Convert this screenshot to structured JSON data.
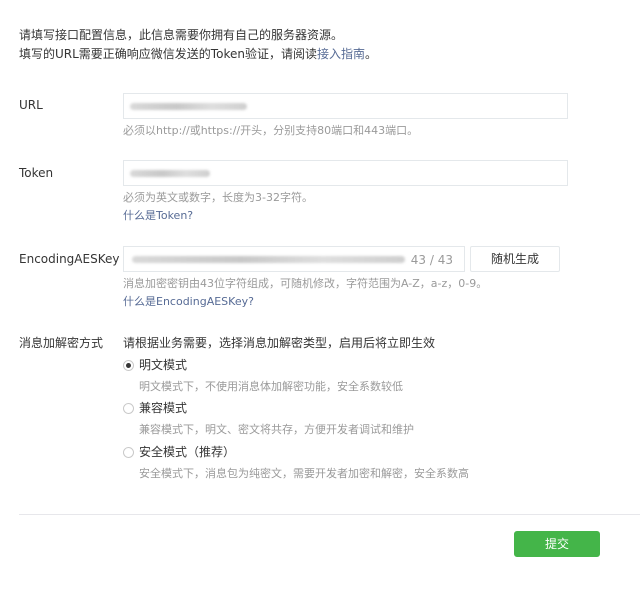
{
  "intro": {
    "line1": "请填写接口配置信息，此信息需要你拥有自己的服务器资源。",
    "line2_prefix": "填写的URL需要正确响应微信发送的Token验证，请阅读",
    "line2_link": "接入指南",
    "line2_suffix": "。"
  },
  "url_field": {
    "label": "URL",
    "hint": "必须以http://或https://开头，分别支持80端口和443端口。"
  },
  "token_field": {
    "label": "Token",
    "hint": "必须为英文或数字，长度为3-32字符。",
    "help_link": "什么是Token?"
  },
  "aes_field": {
    "label": "EncodingAESKey",
    "counter": "43 / 43",
    "generate_button": "随机生成",
    "hint": "消息加密密钥由43位字符组成，可随机修改，字符范围为A-Z，a-z，0-9。",
    "help_link": "什么是EncodingAESKey?"
  },
  "encryption": {
    "label": "消息加解密方式",
    "description": "请根据业务需要，选择消息加解密类型，启用后将立即生效",
    "options": [
      {
        "label": "明文模式",
        "desc": "明文模式下，不使用消息体加解密功能，安全系数较低",
        "checked": true
      },
      {
        "label": "兼容模式",
        "desc": "兼容模式下，明文、密文将共存，方便开发者调试和维护",
        "checked": false
      },
      {
        "label": "安全模式（推荐）",
        "desc": "安全模式下，消息包为纯密文，需要开发者加密和解密，安全系数高",
        "checked": false
      }
    ]
  },
  "footer": {
    "submit_button": "提交"
  },
  "colors": {
    "link": "#576b95",
    "primary_button": "#44b549",
    "hint_text": "#9a9a9a"
  }
}
